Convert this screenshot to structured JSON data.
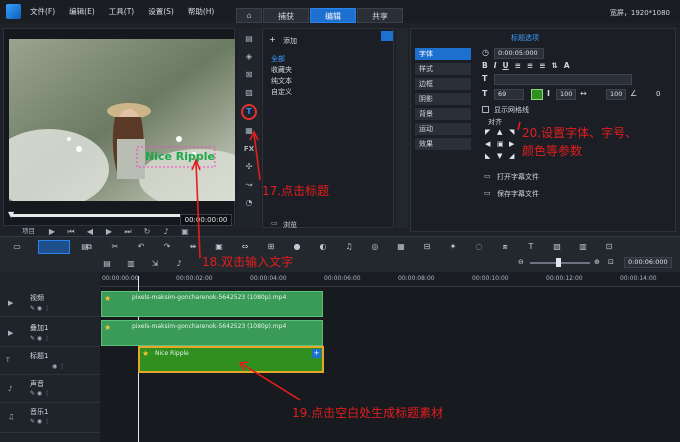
{
  "menu": [
    "文件(F)",
    "编辑(E)",
    "工具(T)",
    "设置(S)",
    "帮助(H)"
  ],
  "tabs": [
    "捕获",
    "编辑",
    "共享"
  ],
  "active_tab": "编辑",
  "resolution": "宽屏，1920*1080",
  "player": {
    "overlay_title": "Nice Ripple",
    "mode_project": "项目",
    "mode_clip": "素材",
    "timecode": "00:00:00:00"
  },
  "library": {
    "add_label": "添加",
    "items": [
      "全部",
      "收藏夹",
      "纯文本",
      "自定义"
    ],
    "browse_label": "浏览"
  },
  "options": {
    "header": "标题选项",
    "categories": [
      "字体",
      "样式",
      "边框",
      "阴影",
      "背景",
      "运动",
      "效果"
    ],
    "selected_category": "字体",
    "duration": "0:00:05:000",
    "font_size": "69",
    "line_spacing": "100",
    "char_spacing": "100",
    "angle": "0",
    "show_grid": "显示网格线",
    "align_label": "对齐",
    "open_subtitle": "打开字幕文件",
    "save_subtitle": "保存字幕文件"
  },
  "ruler": [
    "00:00:00:00",
    "00:00:02:00",
    "00:00:04:00",
    "00:00:06:00",
    "00:00:08:00",
    "00:00:10:00",
    "00:00:12:00",
    "00:00:14:00"
  ],
  "zoom_time": "0:00:06:000",
  "tracks": [
    {
      "name": "视频",
      "clip": "pixels-maksim-goncharenok-5642523 (1080p).mp4"
    },
    {
      "name": "叠加1",
      "clip": "pixels-maksim-goncharenok-5642523 (1080p).mp4"
    },
    {
      "name": "标题1",
      "clip": "Nice Ripple"
    },
    {
      "name": "声音",
      "clip": ""
    },
    {
      "name": "音乐1",
      "clip": ""
    }
  ],
  "annotations": {
    "a17": "17.点击标题",
    "a18": "18.双击输入文字",
    "a19": "19.点击空白处生成标题素材",
    "a20_line1": "20.设置字体、字号、",
    "a20_line2": "颜色等参数"
  },
  "colors": {
    "accent": "#1d6fd0",
    "annotation": "#e41d1d",
    "clip_green": "#3a9a58",
    "title_clip": "#2f8f1f"
  }
}
